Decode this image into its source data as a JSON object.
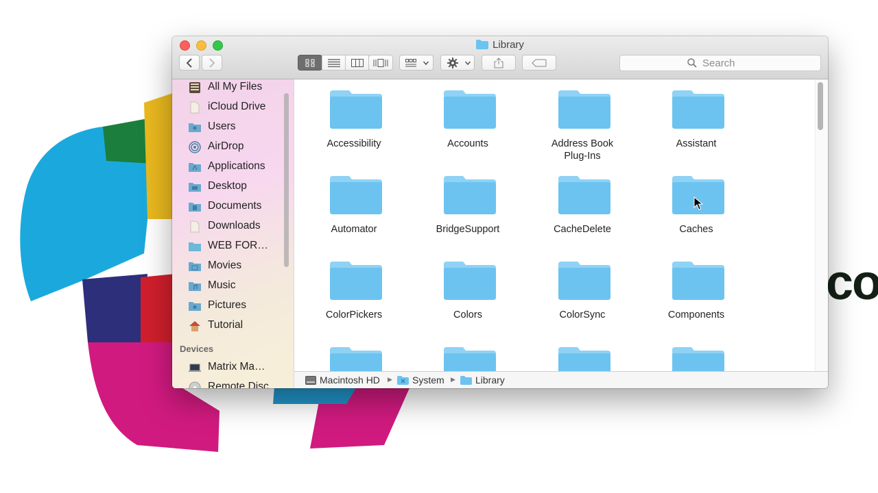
{
  "window": {
    "title": "Library"
  },
  "toolbar": {
    "view_modes": [
      "icon-view",
      "list-view",
      "column-view",
      "coverflow-view"
    ],
    "search_placeholder": "Search"
  },
  "sidebar": {
    "favorites": [
      {
        "label": "All My Files",
        "icon": "all-my-files-icon"
      },
      {
        "label": "iCloud Drive",
        "icon": "icloud-drive-icon"
      },
      {
        "label": "Users",
        "icon": "users-folder-icon"
      },
      {
        "label": "AirDrop",
        "icon": "airdrop-icon"
      },
      {
        "label": "Applications",
        "icon": "applications-folder-icon"
      },
      {
        "label": "Desktop",
        "icon": "desktop-folder-icon"
      },
      {
        "label": "Documents",
        "icon": "documents-folder-icon"
      },
      {
        "label": "Downloads",
        "icon": "downloads-icon"
      },
      {
        "label": "WEB FOR…",
        "icon": "folder-icon"
      },
      {
        "label": "Movies",
        "icon": "movies-folder-icon"
      },
      {
        "label": "Music",
        "icon": "music-folder-icon"
      },
      {
        "label": "Pictures",
        "icon": "pictures-folder-icon"
      },
      {
        "label": "Tutorial",
        "icon": "home-icon"
      }
    ],
    "devices_heading": "Devices",
    "devices": [
      {
        "label": "Matrix Ma…",
        "icon": "laptop-icon"
      },
      {
        "label": "Remote Disc",
        "icon": "remote-disc-icon"
      }
    ]
  },
  "folders": [
    {
      "name": "Accessibility"
    },
    {
      "name": "Accounts"
    },
    {
      "name": "Address Book Plug-Ins"
    },
    {
      "name": "Assistant"
    },
    {
      "name": "Automator"
    },
    {
      "name": "BridgeSupport"
    },
    {
      "name": "CacheDelete"
    },
    {
      "name": "Caches"
    },
    {
      "name": "ColorPickers"
    },
    {
      "name": "Colors"
    },
    {
      "name": "ColorSync"
    },
    {
      "name": "Components"
    },
    {
      "name": ""
    },
    {
      "name": ""
    },
    {
      "name": ""
    },
    {
      "name": ""
    }
  ],
  "pathbar": {
    "crumbs": [
      {
        "label": "Macintosh HD",
        "icon": "hard-drive-icon"
      },
      {
        "label": "System",
        "icon": "system-folder-icon"
      },
      {
        "label": "Library",
        "icon": "folder-icon"
      }
    ]
  },
  "background": {
    "partial_text": "co"
  },
  "colors": {
    "folder": "#6cc3f0",
    "folder_tab": "#8fd2f5",
    "sidebar_gradient_start": "#f2d3e8"
  }
}
